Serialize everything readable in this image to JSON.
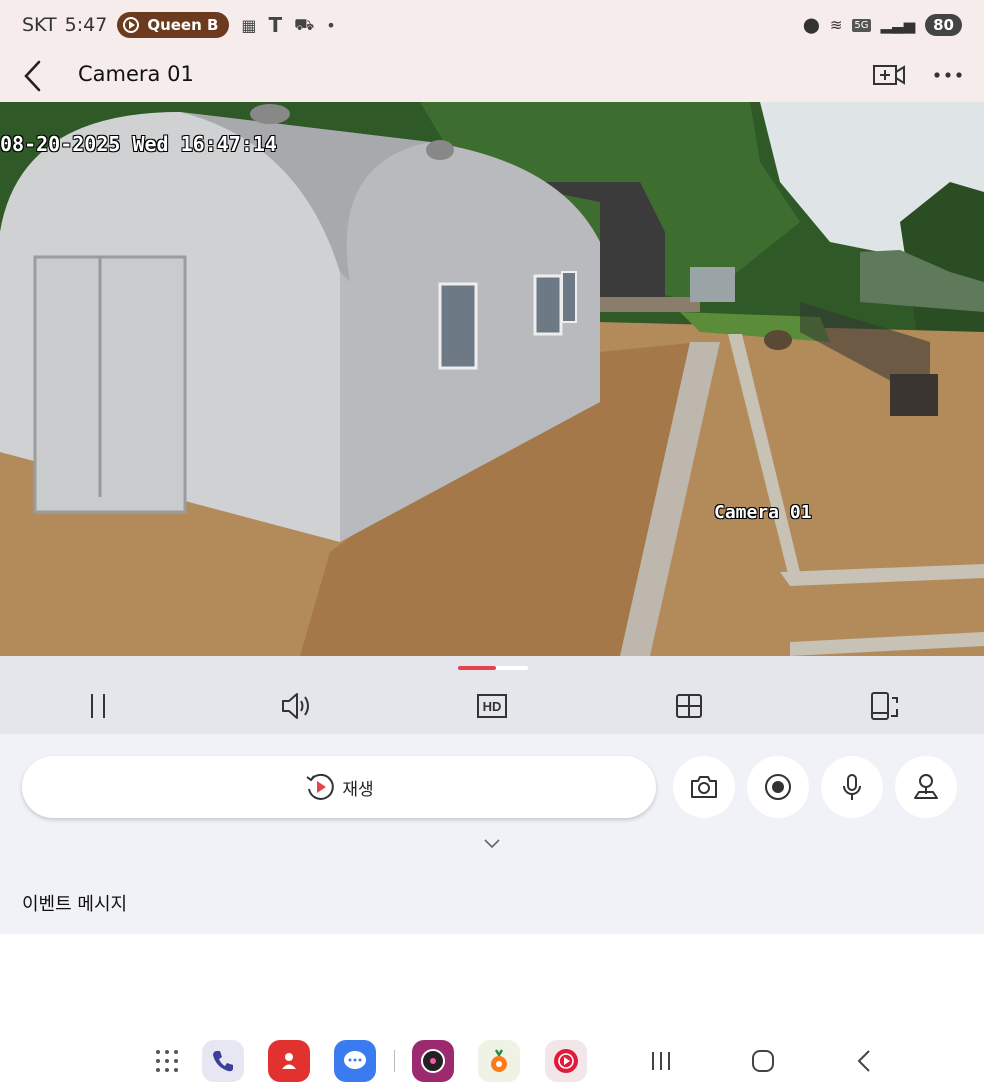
{
  "status_bar": {
    "carrier": "SKT",
    "time": "5:47",
    "media_pill": "Queen B",
    "network": "5G",
    "battery": "80"
  },
  "app_bar": {
    "title": "Camera 01"
  },
  "video": {
    "timestamp": "08-20-2025 Wed 16:47:14",
    "camera_label": "Camera 01"
  },
  "actions": {
    "playback_label": "재생"
  },
  "events": {
    "title": "이벤트 메시지"
  },
  "colors": {
    "accent": "#e8424a",
    "status_bar_bg": "#f6ecec",
    "controls_bg": "#e5e6ec",
    "panel_bg": "#f1f2f7"
  },
  "icons": {
    "back": "chevron-left-icon",
    "add_camera": "add-video-icon",
    "more": "more-horizontal-icon",
    "pause": "pause-icon",
    "volume": "volume-icon",
    "hd": "hd-icon",
    "grid": "grid-icon",
    "rotate": "rotate-device-icon",
    "playback": "replay-icon",
    "snapshot": "camera-icon",
    "record": "record-icon",
    "mic": "microphone-icon",
    "ptz": "joystick-icon"
  }
}
